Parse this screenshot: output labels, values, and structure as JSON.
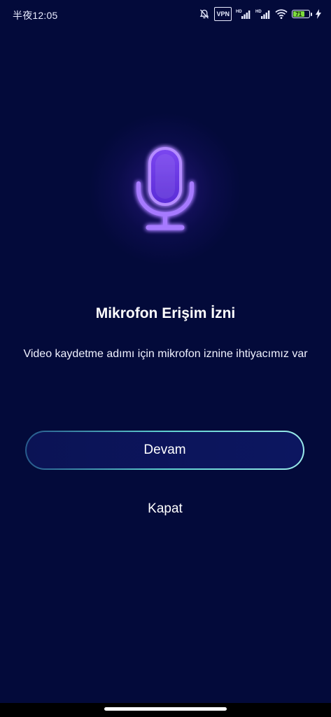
{
  "status_bar": {
    "time": "半夜12:05",
    "vpn": "VPN",
    "battery_level": "71",
    "battery_percent": 71,
    "icons": [
      "bell-off-icon",
      "vpn-icon",
      "signal-hd-icon",
      "signal-hd-icon",
      "wifi-icon",
      "battery-icon",
      "charging-bolt-icon"
    ]
  },
  "permission": {
    "icon": "microphone-icon",
    "accent_color": "#8a4dff",
    "title": "Mikrofon Erişim İzni",
    "description": "Video kaydetme adımı için mikrofon iznine ihtiyacımız var"
  },
  "actions": {
    "continue_label": "Devam",
    "close_label": "Kapat"
  },
  "colors": {
    "background": "#030a3a",
    "button_border": "#5fd0d0",
    "battery": "#7ddb3d"
  }
}
